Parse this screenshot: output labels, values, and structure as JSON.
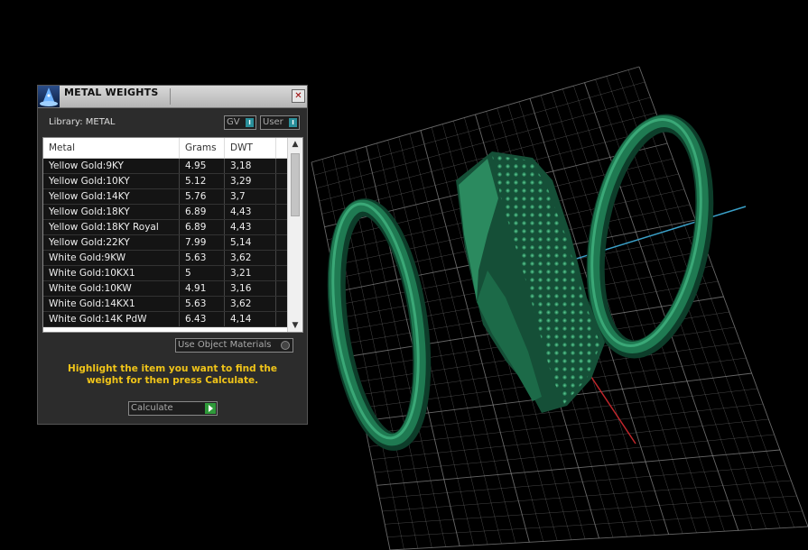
{
  "panel": {
    "title": "METAL WEIGHTS",
    "close_symbol": "✕",
    "library_label": "Library: METAL",
    "gv_label": "GV",
    "user_label": "User",
    "toggle_glyph": "I",
    "columns": [
      "Metal",
      "Grams",
      "DWT"
    ],
    "rows": [
      [
        "Yellow Gold:9KY",
        "4.95",
        "3,18"
      ],
      [
        "Yellow Gold:10KY",
        "5.12",
        "3,29"
      ],
      [
        "Yellow Gold:14KY",
        "5.76",
        "3,7"
      ],
      [
        "Yellow Gold:18KY",
        "6.89",
        "4,43"
      ],
      [
        "Yellow Gold:18KY Royal",
        "6.89",
        "4,43"
      ],
      [
        "Yellow Gold:22KY",
        "7.99",
        "5,14"
      ],
      [
        "White Gold:9KW",
        "5.63",
        "3,62"
      ],
      [
        "White Gold:10KX1",
        "5",
        "3,21"
      ],
      [
        "White Gold:10KW",
        "4.91",
        "3,16"
      ],
      [
        "White Gold:14KX1",
        "5.63",
        "3,62"
      ],
      [
        "White Gold:14K PdW",
        "6.43",
        "4,14"
      ]
    ],
    "use_object_materials_label": "Use Object Materials",
    "instruction": "Highlight the item you want to find the weight for then press Calculate.",
    "calculate_label": "Calculate",
    "scroll_up_symbol": "▲",
    "scroll_down_symbol": "▼"
  },
  "viewport": {
    "object_color": "#1e6b4a",
    "grid_color": "#8a8a8a",
    "axis_x_color": "#c0262b",
    "axis_y_color": "#3aa0c8"
  }
}
